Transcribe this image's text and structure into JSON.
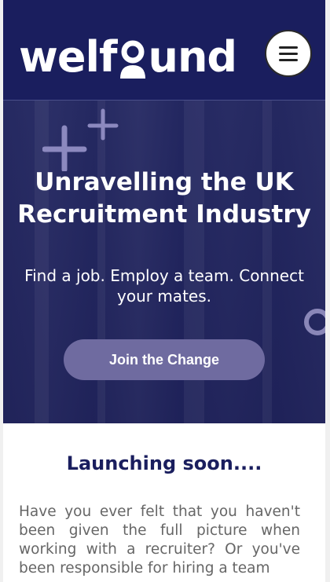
{
  "header": {
    "logo_text_prefix": "welf",
    "logo_text_suffix": "und",
    "logo_alt": "welfound",
    "menu_icon": "hamburger-menu-icon",
    "background": "#1a1e5e"
  },
  "hero": {
    "title": "Unravelling the UK Recruitment Industry",
    "subtitle": "Find a job. Employ a team. Connect your mates.",
    "cta_label": "Join the Change",
    "cta_color": "#6f6ba0"
  },
  "content": {
    "heading": "Launching soon....",
    "paragraph": "Have you ever felt that you haven't been given the full picture when working with a recruiter? Or you've been responsible for hiring a team"
  }
}
